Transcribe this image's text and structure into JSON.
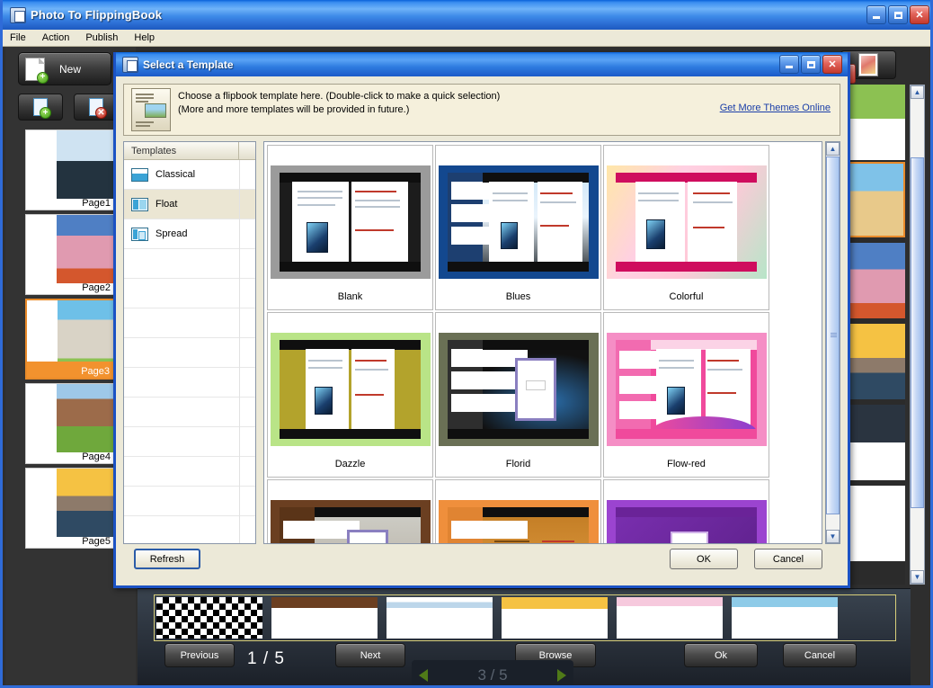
{
  "app": {
    "title": "Photo To FlippingBook",
    "icon": "app-icon",
    "menu": [
      "File",
      "Action",
      "Publish",
      "Help"
    ],
    "window_buttons": [
      "minimize",
      "maximize",
      "close"
    ]
  },
  "toolbar": {
    "new_label": "New",
    "add_page_icon": "add-page-icon",
    "delete_page_icon": "delete-page-icon",
    "photo_tool_icon": "photo-icon"
  },
  "pages_panel": {
    "items": [
      {
        "label": "Page1",
        "selected": false
      },
      {
        "label": "Page2",
        "selected": false
      },
      {
        "label": "Page3",
        "selected": true
      },
      {
        "label": "Page4",
        "selected": false
      },
      {
        "label": "Page5",
        "selected": false
      }
    ]
  },
  "bottom_bar": {
    "previous_label": "Previous",
    "next_label": "Next",
    "browse_label": "Browse",
    "ok_label": "Ok",
    "cancel_label": "Cancel",
    "page_counter": "1 / 5",
    "page_counter_current": "1",
    "page_counter_sep": "/",
    "page_counter_total": "5",
    "inner_counter": "3 / 5"
  },
  "dialog": {
    "title": "Select a Template",
    "icon": "app-icon",
    "window_buttons": [
      "minimize",
      "maximize",
      "close"
    ],
    "info": {
      "line1": "Choose a flipbook template here. (Double-click to make a quick selection)",
      "line2": "(More and more templates will be provided in future.)",
      "link": "Get More Themes Online",
      "icon": "template-preview-icon"
    },
    "categories": {
      "header": "Templates",
      "items": [
        {
          "label": "Classical",
          "icon": "classical-layout-icon",
          "active": false
        },
        {
          "label": "Float",
          "icon": "float-layout-icon",
          "active": true
        },
        {
          "label": "Spread",
          "icon": "spread-layout-icon",
          "active": false
        }
      ],
      "empty_rows": 11
    },
    "templates": [
      {
        "name": "Blank",
        "accent": "#8a8a8a",
        "style": "blank"
      },
      {
        "name": "Blues",
        "accent": "#1e5fa8",
        "style": "blues"
      },
      {
        "name": "Colorful",
        "accent": "#e8348a",
        "style": "colorful"
      },
      {
        "name": "Dazzle",
        "accent": "#a8dd62",
        "style": "dazzle"
      },
      {
        "name": "Florid",
        "accent": "#3b3b2e",
        "style": "florid"
      },
      {
        "name": "Flow-red",
        "accent": "#f45ba8",
        "style": "flowred"
      },
      {
        "name": "",
        "accent": "#6b3f21",
        "style": "room"
      },
      {
        "name": "",
        "accent": "#ef8f3c",
        "style": "orange"
      },
      {
        "name": "",
        "accent": "#9b44d0",
        "style": "purple"
      }
    ],
    "buttons": {
      "refresh": "Refresh",
      "ok": "OK",
      "cancel": "Cancel"
    },
    "scrollbar": {
      "up": "▲",
      "down": "▼"
    }
  },
  "colors": {
    "titlebar_blue": "#2f6bd8",
    "dialog_face": "#ece9d8",
    "info_face": "#f5f0dc",
    "link": "#1a3ea8",
    "selection_orange": "#f2922e",
    "workspace_dark": "#2e2e2e"
  }
}
